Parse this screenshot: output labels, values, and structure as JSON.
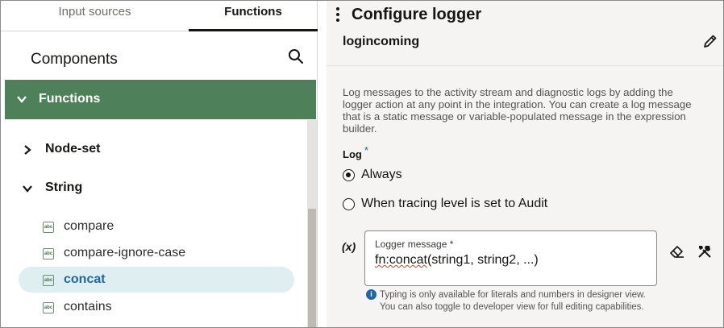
{
  "tabs": [
    {
      "label": "Input sources"
    },
    {
      "label": "Functions"
    }
  ],
  "components": {
    "header": "Components",
    "section": "Functions",
    "categories": [
      "Node-set",
      "String"
    ],
    "items": [
      "compare",
      "compare-ignore-case",
      "concat",
      "contains"
    ],
    "abc_glyph": "abc",
    "selected_item": "concat"
  },
  "panel": {
    "title": "Configure logger",
    "action_name": "logincoming",
    "description": "Log messages to the activity stream and diagnostic logs by adding the logger action at any point in the integration. You can create a log message that is a static message or variable-populated message in the expression builder.",
    "log_label": "Log",
    "required_mark": "*",
    "options": [
      "Always",
      "When tracing level is set to Audit"
    ],
    "selected_option": "Always",
    "variable_icon": "(x)",
    "message_field": {
      "label": "Logger message *",
      "value_prefix": "fn:concat",
      "value_rest": "(string1, string2, ...)"
    },
    "info_glyph": "i",
    "info_text": "Typing is only available for literals and numbers in designer view. You can also toggle to developer view for full editing capabilities."
  },
  "colors": {
    "accent_green": "#4e8159",
    "selected_bg": "#dfeef0",
    "link_blue": "#1f66a7"
  }
}
